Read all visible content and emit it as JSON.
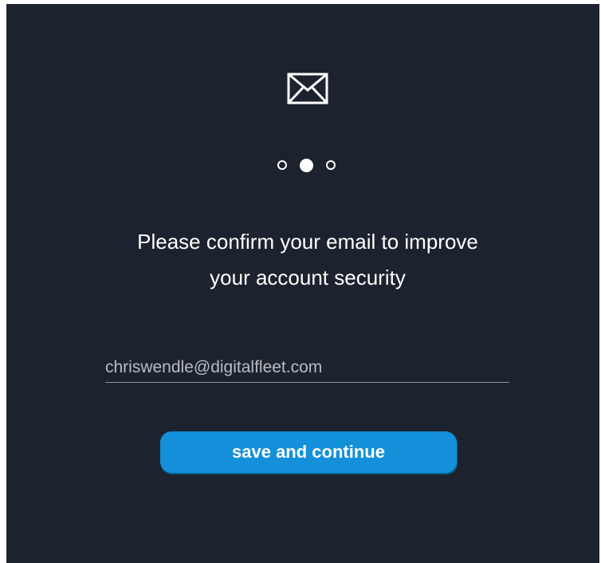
{
  "icons": {
    "mail": "envelope-icon"
  },
  "steps": {
    "total": 3,
    "current": 2
  },
  "prompt": {
    "line1": "Please confirm your email to improve",
    "line2": "your account security"
  },
  "email": {
    "value": "chriswendle@digitalfleet.com"
  },
  "actions": {
    "save_label": "save and continue"
  },
  "colors": {
    "background": "#1d232e",
    "accent": "#1390d9",
    "text": "#ffffff"
  }
}
